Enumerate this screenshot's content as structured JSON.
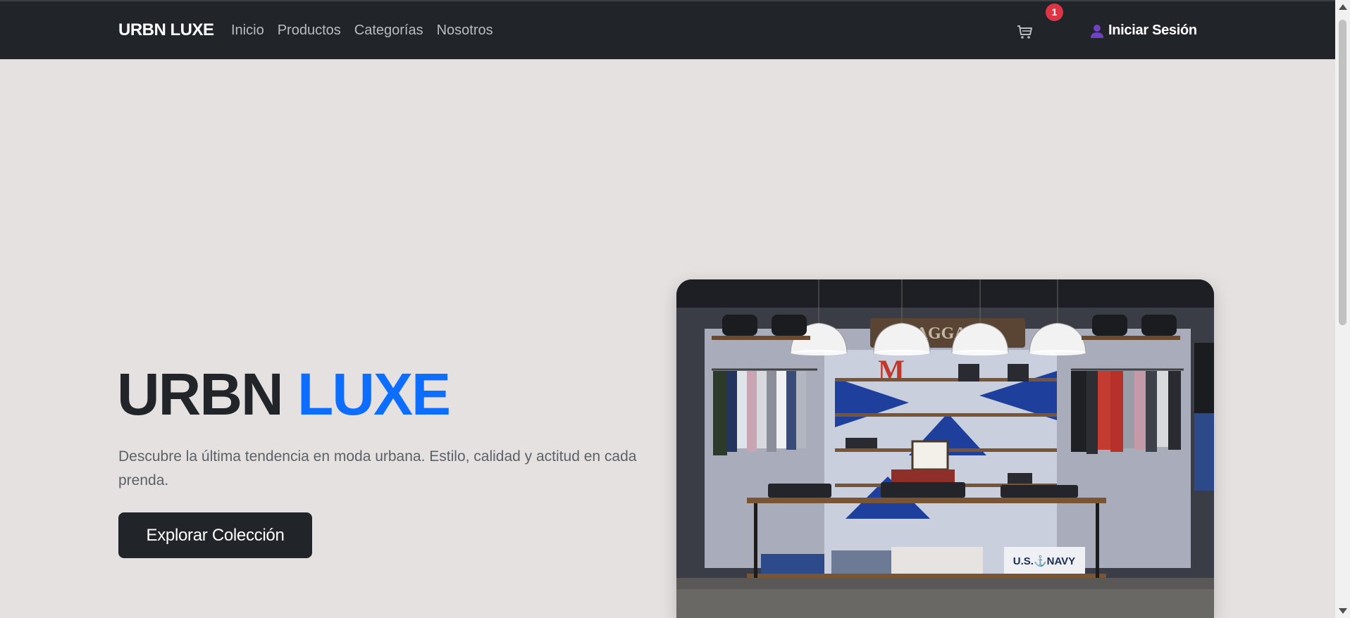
{
  "nav": {
    "brand": "URBN LUXE",
    "links": [
      "Inicio",
      "Productos",
      "Categorías",
      "Nosotros"
    ],
    "cart_icon": "cart-icon",
    "cart_count": "1",
    "user_icon": "user-icon",
    "login_label": "Iniciar Sesión"
  },
  "hero": {
    "title_main": "URBN",
    "title_accent": "LUXE",
    "description": "Descubre la última tendencia en moda urbana. Estilo, calidad y actitud en cada prenda.",
    "cta_label": "Explorar Colección",
    "image_sign_text": "BAGGAGE",
    "image_letter": "M",
    "image_box_text": "U.S.⚓NAVY"
  },
  "colors": {
    "navbar_bg": "#212429",
    "page_bg": "#e5e1e0",
    "accent": "#0d6efd",
    "badge": "#dc3545"
  }
}
